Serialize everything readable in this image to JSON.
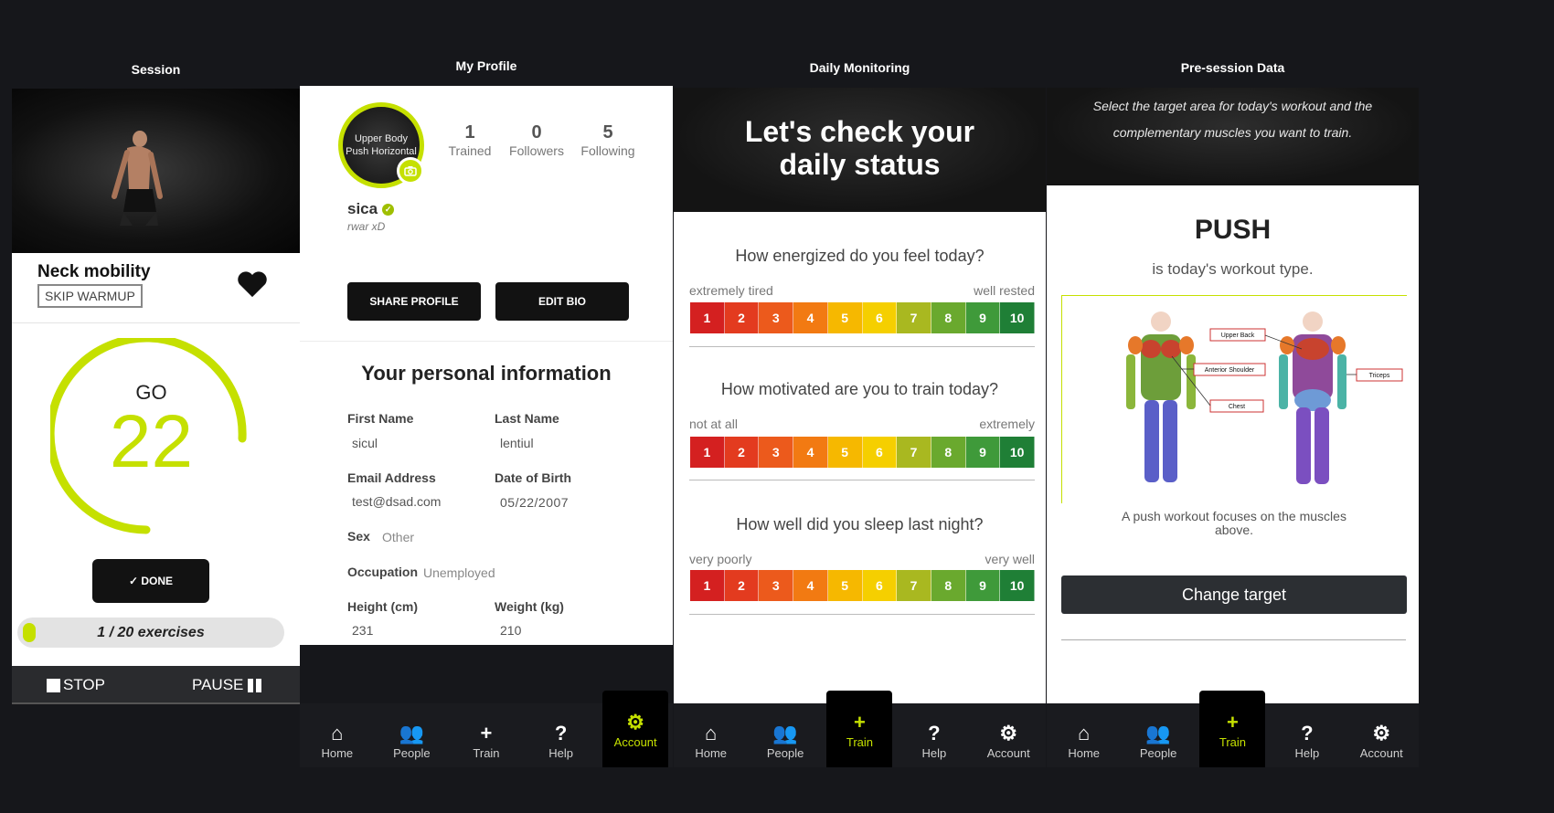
{
  "colors": {
    "accent": "#c5e000",
    "dark": "#1a1b1f",
    "black": "#121212"
  },
  "session": {
    "header": "Session",
    "exercise_title": "Neck mobility",
    "skip_label": "SKIP WARMUP",
    "go_label": "GO",
    "countdown": "22",
    "done_label": "✓ DONE",
    "progress_text": "1 / 20 exercises",
    "progress_fraction": 0.05,
    "stop_label": "STOP",
    "pause_label": "PAUSE"
  },
  "profile": {
    "header": "My Profile",
    "avatar_text_1": "Upper Body",
    "avatar_text_2": "Push Horizontal",
    "stats": [
      {
        "value": "1",
        "label": "Trained"
      },
      {
        "value": "0",
        "label": "Followers"
      },
      {
        "value": "5",
        "label": "Following"
      }
    ],
    "username": "sica",
    "bio": "rwar xD",
    "share_label": "SHARE PROFILE",
    "edit_label": "EDIT BIO",
    "section_title": "Your personal information",
    "first_name_label": "First Name",
    "first_name": "sicul",
    "last_name_label": "Last Name",
    "last_name": "lentiul",
    "email_label": "Email Address",
    "email": "test@dsad.com",
    "dob_label": "Date of Birth",
    "dob": "05/22/2007",
    "sex_label": "Sex",
    "sex": "Other",
    "occupation_label": "Occupation",
    "occupation": "Unemployed",
    "height_label": "Height (cm)",
    "height": "231",
    "weight_label": "Weight (kg)",
    "weight": "210"
  },
  "monitoring": {
    "header": "Daily Monitoring",
    "hero_line1": "Let's check your",
    "hero_line2": "daily status",
    "questions": [
      {
        "q": "How energized do you feel today?",
        "low": "extremely tired",
        "high": "well rested"
      },
      {
        "q": "How motivated are you to train today?",
        "low": "not at all",
        "high": "extremely"
      },
      {
        "q": "How well did you sleep last night?",
        "low": "very poorly",
        "high": "very well"
      }
    ],
    "scale": [
      "1",
      "2",
      "3",
      "4",
      "5",
      "6",
      "7",
      "8",
      "9",
      "10"
    ],
    "scale_colors": [
      "#d42020",
      "#e33b1f",
      "#ec5a1c",
      "#f27a12",
      "#f6b800",
      "#f5cf00",
      "#a9b820",
      "#6aa92e",
      "#3f9a3a",
      "#1f7f36"
    ]
  },
  "presession": {
    "header": "Pre-session Data",
    "hero_text_1": "Select the target area for today's workout and the",
    "hero_text_2": "complementary muscles you want to train.",
    "workout_type": "PUSH",
    "workout_sub": "is today's workout type.",
    "label_upper_back": "Upper Back",
    "label_anterior": "Anterior Shoulder",
    "label_chest": "Chest",
    "label_triceps": "Triceps",
    "caption": "A push workout focuses on the muscles above.",
    "change_label": "Change target"
  },
  "nav": {
    "home": "Home",
    "people": "People",
    "train": "Train",
    "help": "Help",
    "account": "Account"
  }
}
